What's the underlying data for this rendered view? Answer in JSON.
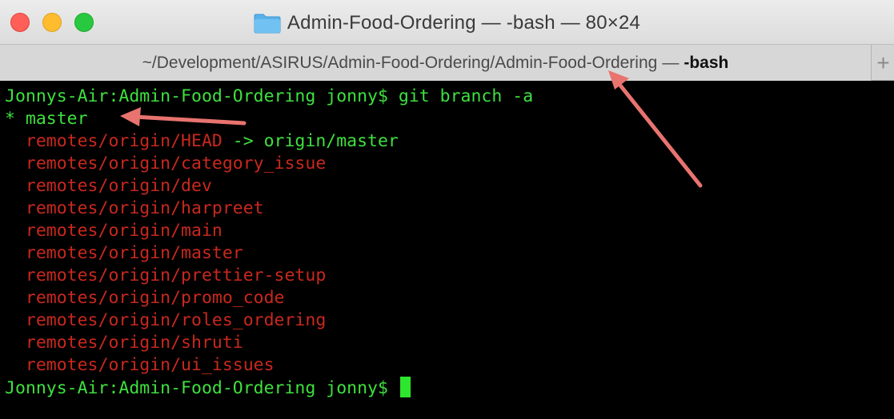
{
  "window": {
    "title": "Admin-Food-Ordering — -bash — 80×24"
  },
  "tab": {
    "path": "~/Development/ASIRUS/Admin-Food-Ordering/Admin-Food-Ordering",
    "separator": "—",
    "process": "-bash",
    "new_tab_symbol": "+"
  },
  "terminal": {
    "command_line": "Jonnys-Air:Admin-Food-Ordering jonny$ git branch -a",
    "current_branch": "* master",
    "head_ref": "  remotes/origin/HEAD",
    "head_arrow": " -> origin/master",
    "remote_branches": [
      "  remotes/origin/category_issue",
      "  remotes/origin/dev",
      "  remotes/origin/harpreet",
      "  remotes/origin/main",
      "  remotes/origin/master",
      "  remotes/origin/prettier-setup",
      "  remotes/origin/promo_code",
      "  remotes/origin/roles_ordering",
      "  remotes/origin/shruti",
      "  remotes/origin/ui_issues"
    ],
    "prompt": "Jonnys-Air:Admin-Food-Ordering jonny$ "
  },
  "icons": {
    "folder": "folder-icon",
    "annotation_arrow_color": "#e8736f"
  },
  "colors": {
    "prompt_green": "#3ee03e",
    "remote_red": "#c8281e",
    "cursor": "#2ee62e"
  }
}
